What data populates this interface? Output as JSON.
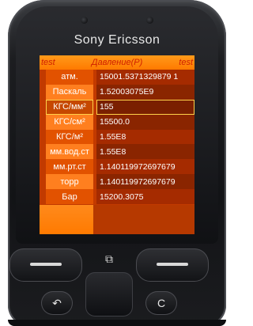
{
  "device": {
    "brand": "Sony Ericsson",
    "menu_glyph": "⧉",
    "back_glyph": "↶",
    "clear_label": "C"
  },
  "app": {
    "title_left": "test",
    "title": "Давление(P)",
    "title_right": "test"
  },
  "conversions": [
    {
      "unit": "атм.",
      "value": "15001.5371329879 1"
    },
    {
      "unit": "Паскаль",
      "value": "1.52003075E9"
    },
    {
      "unit": "КГС/мм²",
      "value": "155"
    },
    {
      "unit": "КГС/см²",
      "value": "15500.0"
    },
    {
      "unit": "КГС/м²",
      "value": "1.55E8"
    },
    {
      "unit": "мм.вод.ст",
      "value": "1.55E8"
    },
    {
      "unit": "мм.рт.ст",
      "value": "1.140119972697679"
    },
    {
      "unit": "торр",
      "value": "1.140119972697679"
    },
    {
      "unit": "Бар",
      "value": "15200.3075"
    }
  ],
  "selected_unit": "КГС/мм²",
  "colors": {
    "screen_orange": "#ff7a00",
    "row_dark": "#a52b00",
    "title_text": "#d02000"
  }
}
